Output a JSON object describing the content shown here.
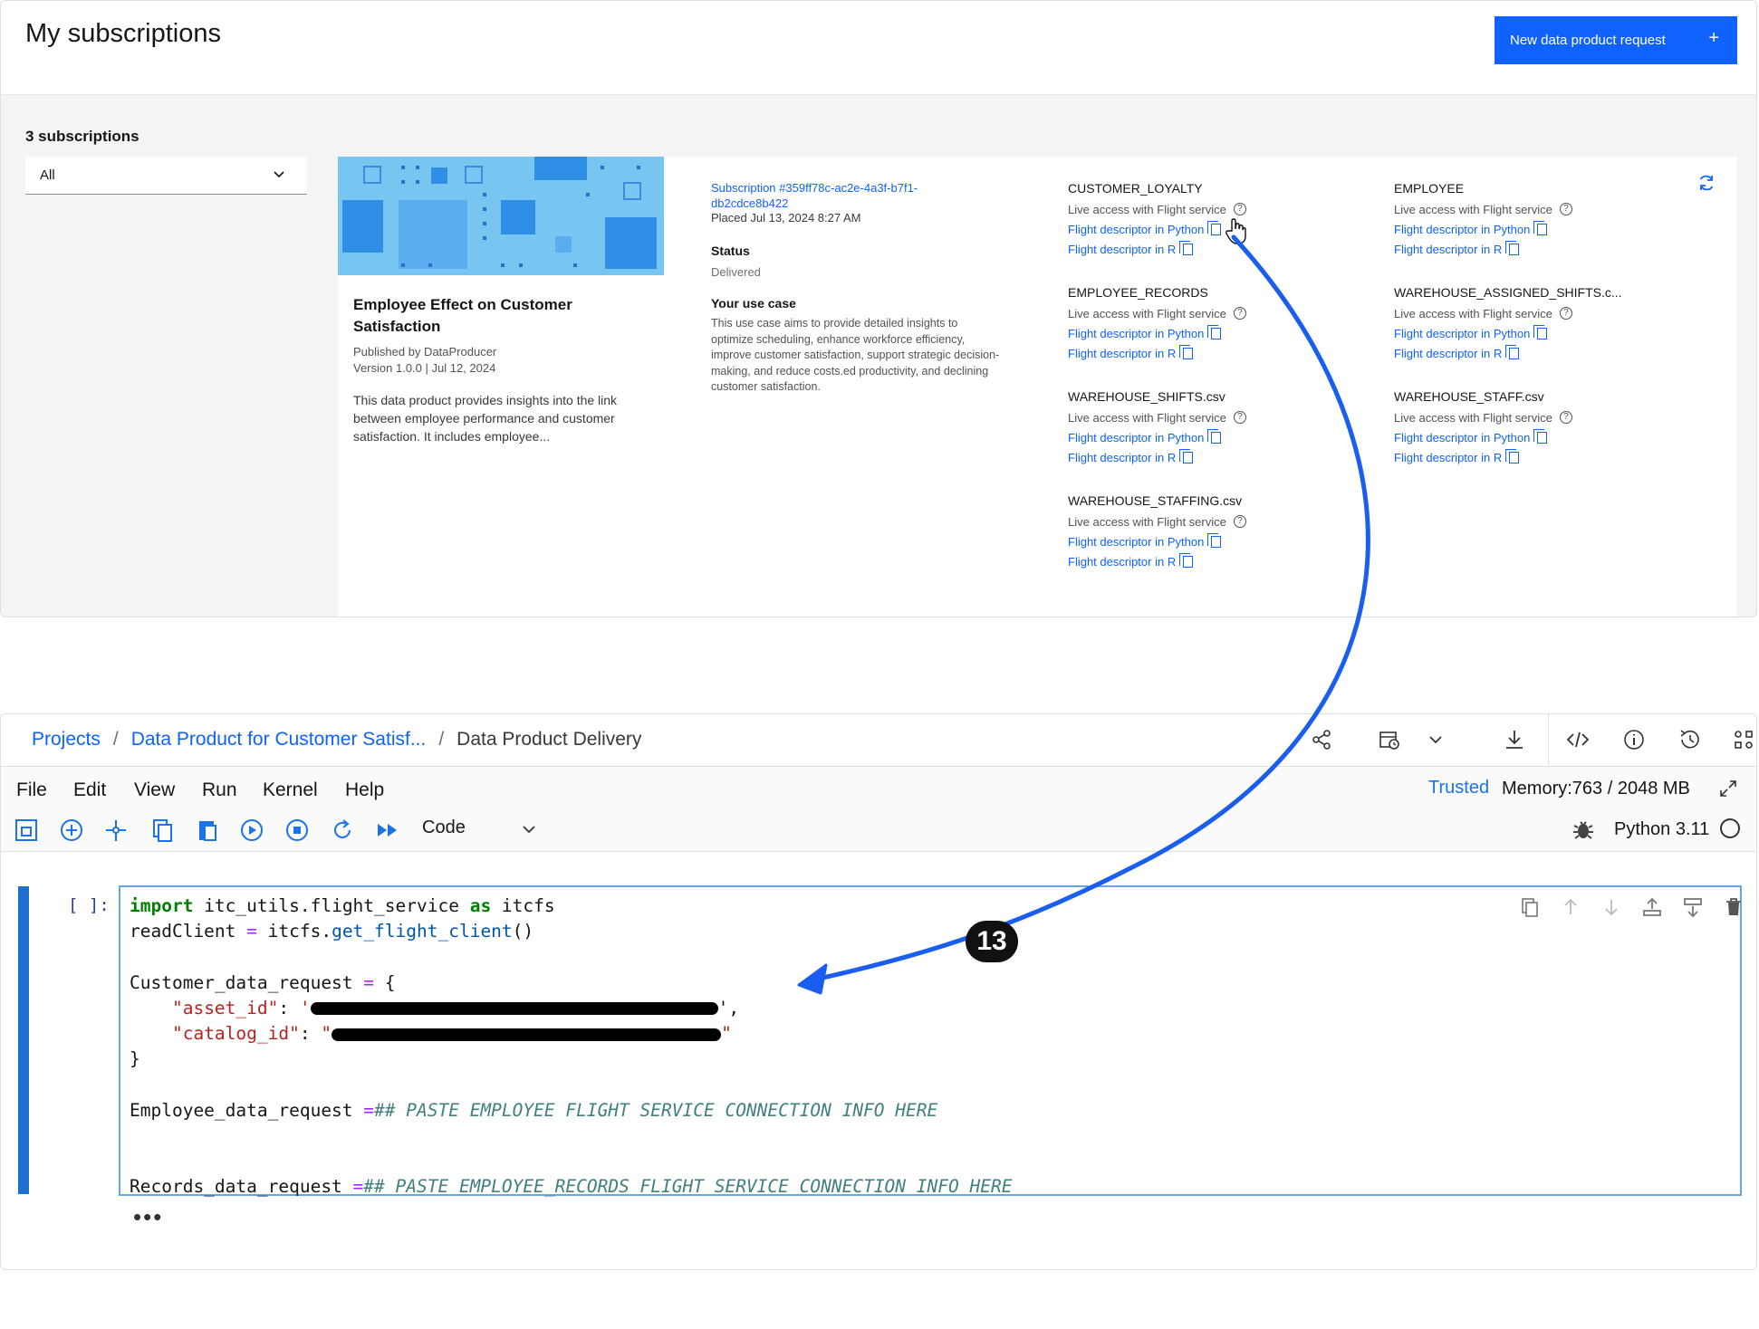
{
  "subscriptions_page": {
    "title": "My subscriptions",
    "new_request_label": "New data product request",
    "new_request_plus": "+",
    "count_label": "3 subscriptions",
    "filter_value": "All"
  },
  "subscription": {
    "product_title": "Employee Effect on Customer Satisfaction",
    "publisher": "Published by DataProducer",
    "version": "Version 1.0.0  |  Jul 12, 2024",
    "description": "This data product provides insights into the link between employee performance and customer satisfaction. It includes employee...",
    "id_text": "Subscription #359ff78c-ac2e-4a3f-b7f1-db2cdce8b422",
    "placed": "Placed Jul 13, 2024 8:27 AM",
    "status_label": "Status",
    "status_value": "Delivered",
    "usecase_label": "Your use case",
    "usecase_text": "This use case aims to provide detailed insights to optimize scheduling, enhance workforce efficiency, improve customer satisfaction, support strategic decision-making, and reduce costs.ed productivity, and declining customer satisfaction.",
    "assets": [
      {
        "name": "CUSTOMER_LOYALTY",
        "live": "Live access with Flight service",
        "python": "Flight descriptor in Python",
        "r": "Flight descriptor in R"
      },
      {
        "name": "EMPLOYEE",
        "live": "Live access with Flight service",
        "python": "Flight descriptor in Python",
        "r": "Flight descriptor in R"
      },
      {
        "name": "EMPLOYEE_RECORDS",
        "live": "Live access with Flight service",
        "python": "Flight descriptor in Python",
        "r": "Flight descriptor in R"
      },
      {
        "name": "WAREHOUSE_ASSIGNED_SHIFTS.c...",
        "live": "Live access with Flight service",
        "python": "Flight descriptor in Python",
        "r": "Flight descriptor in R"
      },
      {
        "name": "WAREHOUSE_SHIFTS.csv",
        "live": "Live access with Flight service",
        "python": "Flight descriptor in Python",
        "r": "Flight descriptor in R"
      },
      {
        "name": "WAREHOUSE_STAFF.csv",
        "live": "Live access with Flight service",
        "python": "Flight descriptor in Python",
        "r": "Flight descriptor in R"
      },
      {
        "name": "WAREHOUSE_STAFFING.csv",
        "live": "Live access with Flight service",
        "python": "Flight descriptor in Python",
        "r": "Flight descriptor in R"
      }
    ]
  },
  "notebook": {
    "breadcrumb": [
      "Projects",
      "/",
      "Data Product for Customer Satisf...",
      "/",
      "Data Product Delivery"
    ],
    "menu": [
      "File",
      "Edit",
      "View",
      "Run",
      "Kernel",
      "Help"
    ],
    "trusted": "Trusted",
    "memory": "Memory:763 / 2048 MB",
    "cell_type": "Code",
    "kernel": "Python 3.11",
    "prompt": "[ ]:",
    "code": {
      "l1_kw": "import",
      "l1_mod": " itc_utils.flight_service ",
      "l1_as": "as",
      "l1_alias": " itcfs",
      "l2_var": "readClient ",
      "l2_eq": "=",
      "l2_obj": " itcfs.",
      "l2_fn": "get_flight_client",
      "l2_paren": "()",
      "l4_var": "Customer_data_request ",
      "l4_eq": "=",
      "l4_brace": " {",
      "l5_key": "\"asset_id\"",
      "l5_colon": ": ",
      "l5_q": "'",
      "l5_end": "',",
      "l6_key": "\"catalog_id\"",
      "l6_colon": ": ",
      "l6_q": "\"",
      "l6_end": "\"",
      "l7": "}",
      "l9_var": "Employee_data_request ",
      "l9_eq": "=",
      "l9_cm": "## PASTE EMPLOYEE FLIGHT SERVICE CONNECTION INFO HERE",
      "l12_var": "Records_data_request ",
      "l12_eq": "=",
      "l12_cm": "## PASTE EMPLOYEE_RECORDS FLIGHT SERVICE CONNECTION INFO HERE"
    },
    "ellipsis": "•••"
  },
  "annotation": {
    "step": "13",
    "arrow_color": "#1a5ef0"
  },
  "colors": {
    "accent": "#0f62fe",
    "code_keyword": "#008000",
    "code_string": "#ba2121",
    "code_comment": "#408080"
  }
}
